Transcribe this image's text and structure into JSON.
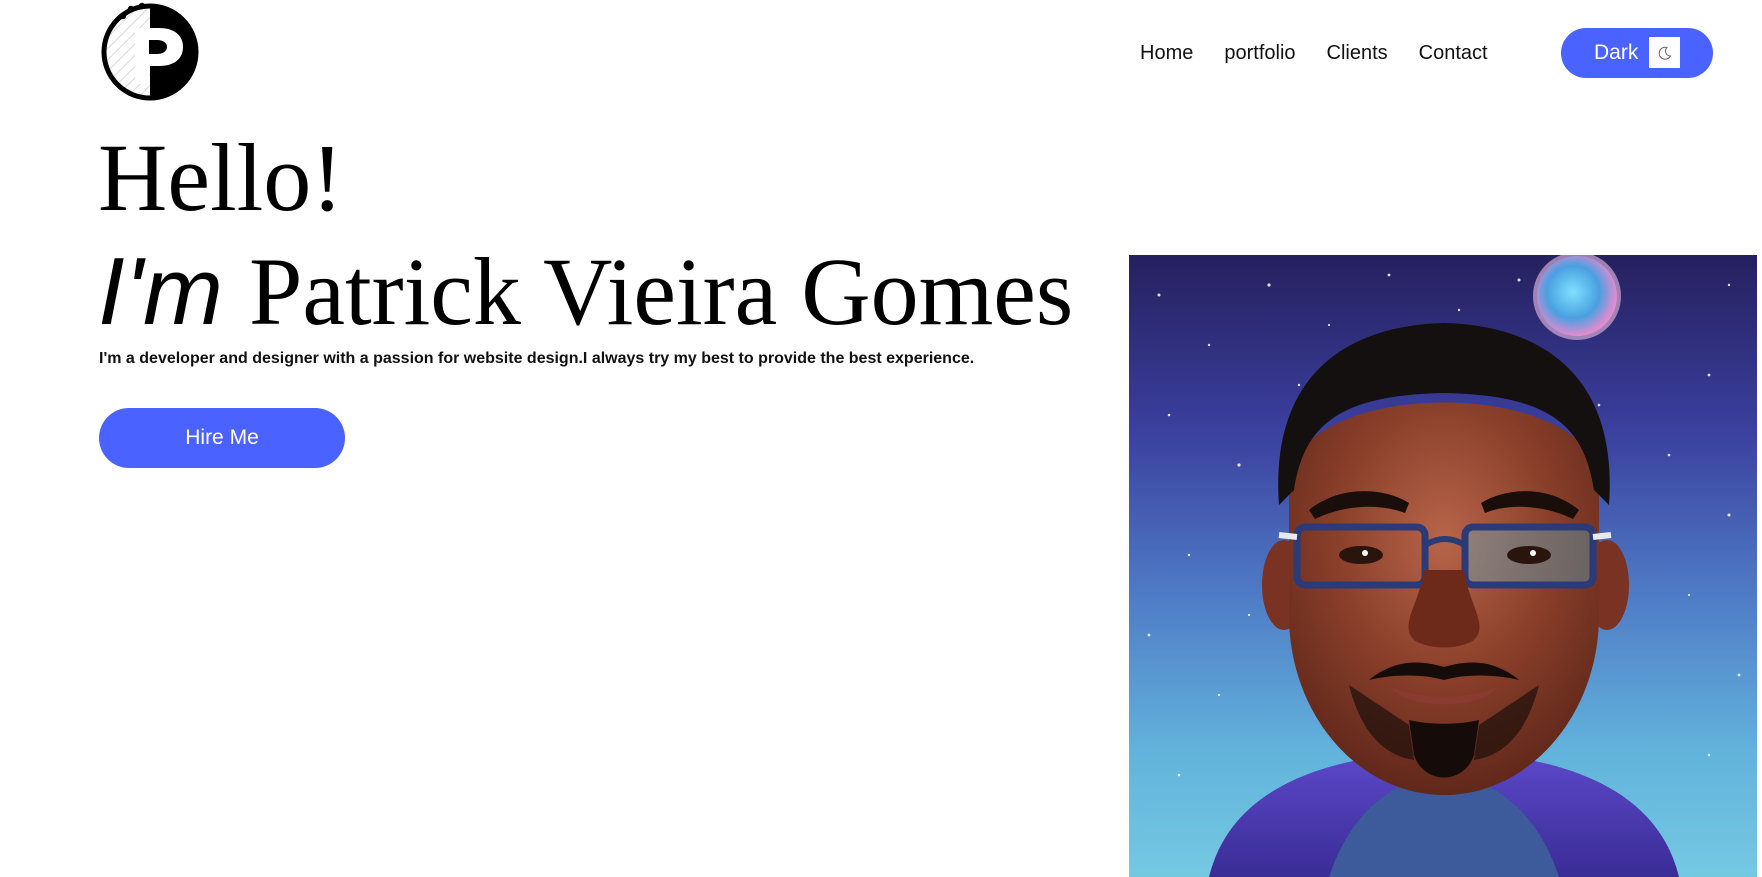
{
  "header": {
    "logo_icon": "p-letter-logo-icon",
    "nav": [
      {
        "label": "Home"
      },
      {
        "label": "portfolio"
      },
      {
        "label": "Clients"
      },
      {
        "label": "Contact"
      }
    ],
    "theme_toggle": {
      "label": "Dark",
      "icon": "moon-icon"
    }
  },
  "hero": {
    "greeting": "Hello!",
    "im": "I'm",
    "name": "Patrick Vieira Gomes",
    "tagline": "I'm a developer and designer with a passion for website design.I always try my best to provide the best experience.",
    "cta": "Hire Me"
  },
  "colors": {
    "accent": "#4a62ff",
    "text": "#000000",
    "background": "#ffffff"
  }
}
